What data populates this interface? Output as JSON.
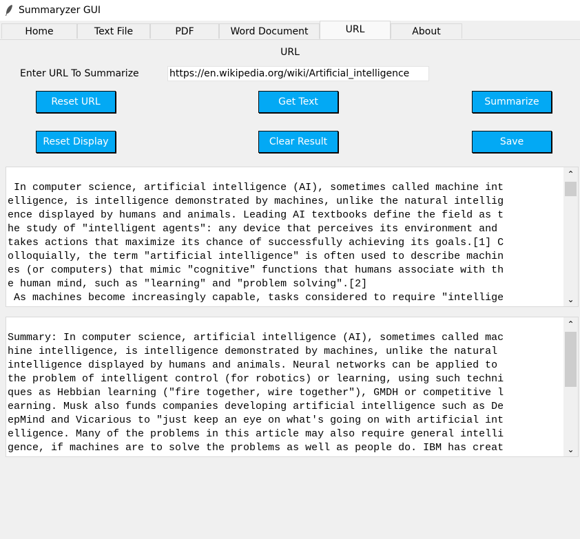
{
  "window": {
    "title": "Summaryzer GUI"
  },
  "tabs": [
    {
      "label": "Home"
    },
    {
      "label": "Text File"
    },
    {
      "label": "PDF"
    },
    {
      "label": "Word Document"
    },
    {
      "label": "URL"
    },
    {
      "label": "About"
    }
  ],
  "main": {
    "section_label": "URL",
    "url_label": "Enter URL To Summarize",
    "url_value": "https://en.wikipedia.org/wiki/Artificial_intelligence",
    "buttons": {
      "reset_url": "Reset URL",
      "get_text": "Get Text",
      "summarize": "Summarize",
      "reset_display": "Reset Display",
      "clear_result": "Clear Result",
      "save": "Save"
    },
    "colors": {
      "button_bg": "#03a9f4",
      "button_text": "#ffffff"
    },
    "text_display": {
      "lines": [
        "",
        " In computer science, artificial intelligence (AI), sometimes called machine int",
        "elligence, is intelligence demonstrated by machines, unlike the natural intellig",
        "ence displayed by humans and animals. Leading AI textbooks define the field as t",
        "he study of \"intelligent agents\": any device that perceives its environment and",
        "takes actions that maximize its chance of successfully achieving its goals.[1] C",
        "olloquially, the term \"artificial intelligence\" is often used to describe machin",
        "es (or computers) that mimic \"cognitive\" functions that humans associate with th",
        "e human mind, such as \"learning\" and \"problem solving\".[2]",
        " As machines become increasingly capable, tasks considered to require \"intellige"
      ]
    },
    "summary_display": {
      "lines": [
        "",
        "Summary: In computer science, artificial intelligence (AI), sometimes called mac",
        "hine intelligence, is intelligence demonstrated by machines, unlike the natural ",
        "intelligence displayed by humans and animals. Neural networks can be applied to ",
        "the problem of intelligent control (for robotics) or learning, using such techni",
        "ques as Hebbian learning (\"fire together, wire together\"), GMDH or competitive l",
        "earning. Musk also funds companies developing artificial intelligence such as De",
        "epMind and Vicarious to \"just keep an eye on what's going on with artificial int",
        "elligence. Many of the problems in this article may also require general intelli",
        "gence, if machines are to solve the problems as well as people do. IBM has creat"
      ]
    },
    "scrollbar": {
      "up_icon": "chevron-up-icon",
      "down_icon": "chevron-down-icon"
    }
  }
}
